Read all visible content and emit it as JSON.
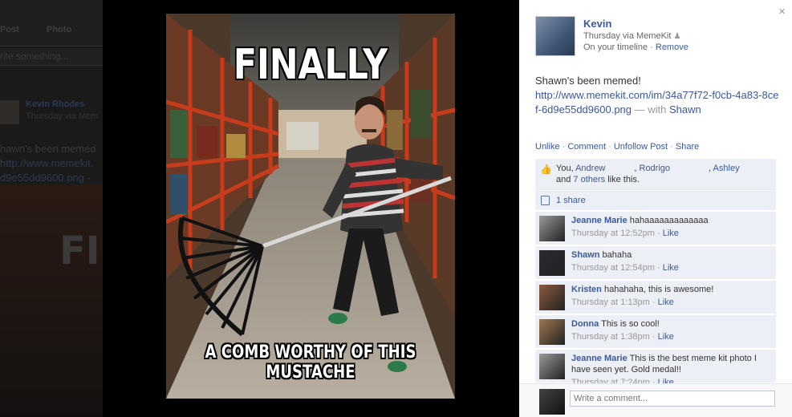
{
  "background_feed": {
    "post_tab": "Post",
    "photo_tab": "Photo",
    "composer_placeholder": "rite something...",
    "author": "Kevin Rhodes",
    "sub": "Thursday via Mem",
    "text_line": "hawn's been memed",
    "link_line_1": "http://www.memekit.",
    "link_line_2": "d9e55dd9600.png -",
    "bg_word": "FI"
  },
  "photo": {
    "top_text": "FINALLY",
    "bottom_text": "A COMB WORTHY OF THIS MUSTACHE"
  },
  "panel": {
    "close_glyph": "×",
    "author": "Kevin",
    "meta": "Thursday via MemeKit",
    "timeline_prefix": "On your timeline · ",
    "remove_label": "Remove",
    "post_text": "Shawn's been memed!",
    "post_link": "http://www.memekit.com/im/34a77f72-f0cb-4a83-8cef-6d9e55dd9600.png",
    "with_prefix": " — with ",
    "with_name": "Shawn",
    "actions": {
      "unlike": "Unlike",
      "comment": "Comment",
      "unfollow": "Unfollow Post",
      "share": "Share",
      "sep": " · "
    },
    "likes": {
      "prefix": "You, ",
      "names": [
        "Andrew",
        "Rodrigo",
        "Ashley"
      ],
      "and": "and ",
      "others": "7 others",
      "suffix": " like this."
    },
    "shares": "1 share",
    "comments": [
      {
        "name": "Jeanne Marie",
        "text": "hahaaaaaaaaaaaaa",
        "time": "Thursday at 12:52pm",
        "like": "Like",
        "avatar_color": "#9a9a9a"
      },
      {
        "name": "Shawn",
        "text": "bahaha",
        "time": "Thursday at 12:54pm",
        "like": "Like",
        "avatar_color": "#2b2b30"
      },
      {
        "name": "Kristen",
        "text": "hahahaha, this is awesome!",
        "time": "Thursday at 1:13pm",
        "like": "Like",
        "avatar_color": "#8b5a3c"
      },
      {
        "name": "Donna",
        "text": "This is so cool!",
        "time": "Thursday at 1:38pm",
        "like": "Like",
        "avatar_color": "#a07850"
      },
      {
        "name": "Jeanne Marie",
        "text": "This is the best meme kit photo I have seen yet. Gold medal!!",
        "time": "Thursday at 7:24pm",
        "like": "Like",
        "avatar_color": "#9a9a9a"
      }
    ],
    "comment_placeholder": "Write a comment...",
    "link_color": "#3b5998"
  }
}
